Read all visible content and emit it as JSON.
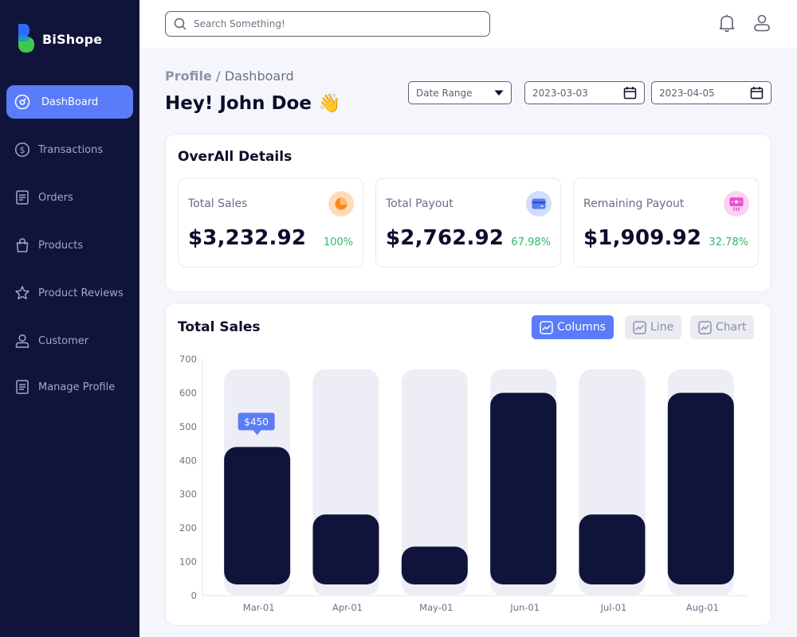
{
  "brand": {
    "name": "BiShope"
  },
  "sidebar": {
    "items": [
      {
        "label": "DashBoard",
        "icon": "dashboard-icon",
        "active": true
      },
      {
        "label": "Transactions",
        "icon": "dollar-circle-icon"
      },
      {
        "label": "Orders",
        "icon": "receipt-icon"
      },
      {
        "label": "Products",
        "icon": "bag-icon"
      },
      {
        "label": "Product Reviews",
        "icon": "star-icon"
      },
      {
        "label": "Customer",
        "icon": "user-icon"
      },
      {
        "label": "Manage Profile",
        "icon": "document-icon"
      }
    ]
  },
  "topbar": {
    "search_placeholder": "Search Something!",
    "notification_icon": "bell-icon",
    "profile_icon": "user-icon"
  },
  "header": {
    "breadcrumb_root": "Profile",
    "breadcrumb_sep": "/",
    "breadcrumb_current": "Dashboard",
    "greeting": "Hey! John Doe",
    "greeting_emoji": "👋"
  },
  "filters": {
    "date_range_label": "Date Range",
    "start_date": "2023-03-03",
    "end_date": "2023-04-05"
  },
  "overall": {
    "title": "OverAll Details",
    "stats": [
      {
        "label": "Total Sales",
        "value": "$3,232.92",
        "percent": "100%",
        "icon": "pie-chart-icon",
        "icon_bg": "#ffdcb8",
        "icon_color": "#f7891c"
      },
      {
        "label": "Total Payout",
        "value": "$2,762.92",
        "percent": "67.98%",
        "icon": "credit-card-icon",
        "icon_bg": "#d4dcfb",
        "icon_color": "#5a7cf8"
      },
      {
        "label": "Remaining Payout",
        "value": "$1,909.92",
        "percent": "32.78%",
        "icon": "cash-icon",
        "icon_bg": "#fbd2f3",
        "icon_color": "#ea4fd0"
      }
    ]
  },
  "sales": {
    "title": "Total Sales",
    "views": [
      {
        "label": "Columns",
        "active": true
      },
      {
        "label": "Line",
        "active": false
      },
      {
        "label": "Chart",
        "active": false
      }
    ]
  },
  "chart_data": {
    "type": "bar",
    "title": "Total Sales",
    "categories": [
      "Mar-01",
      "Apr-01",
      "May-01",
      "Jun-01",
      "Jul-01",
      "Aug-01"
    ],
    "values": [
      440,
      240,
      145,
      600,
      240,
      600
    ],
    "background_max": 670,
    "yticks": [
      0,
      100,
      200,
      300,
      400,
      500,
      600,
      700
    ],
    "ylim": [
      0,
      700
    ],
    "tooltip": {
      "index": 0,
      "text": "$450"
    },
    "colors": {
      "bar": "#11143a",
      "track": "#ededf6",
      "accent": "#5a7cf8"
    }
  },
  "theme": {
    "sidebar_bg": "#11143a",
    "accent": "#5a7cf8",
    "positive": "#2bbb6c"
  }
}
